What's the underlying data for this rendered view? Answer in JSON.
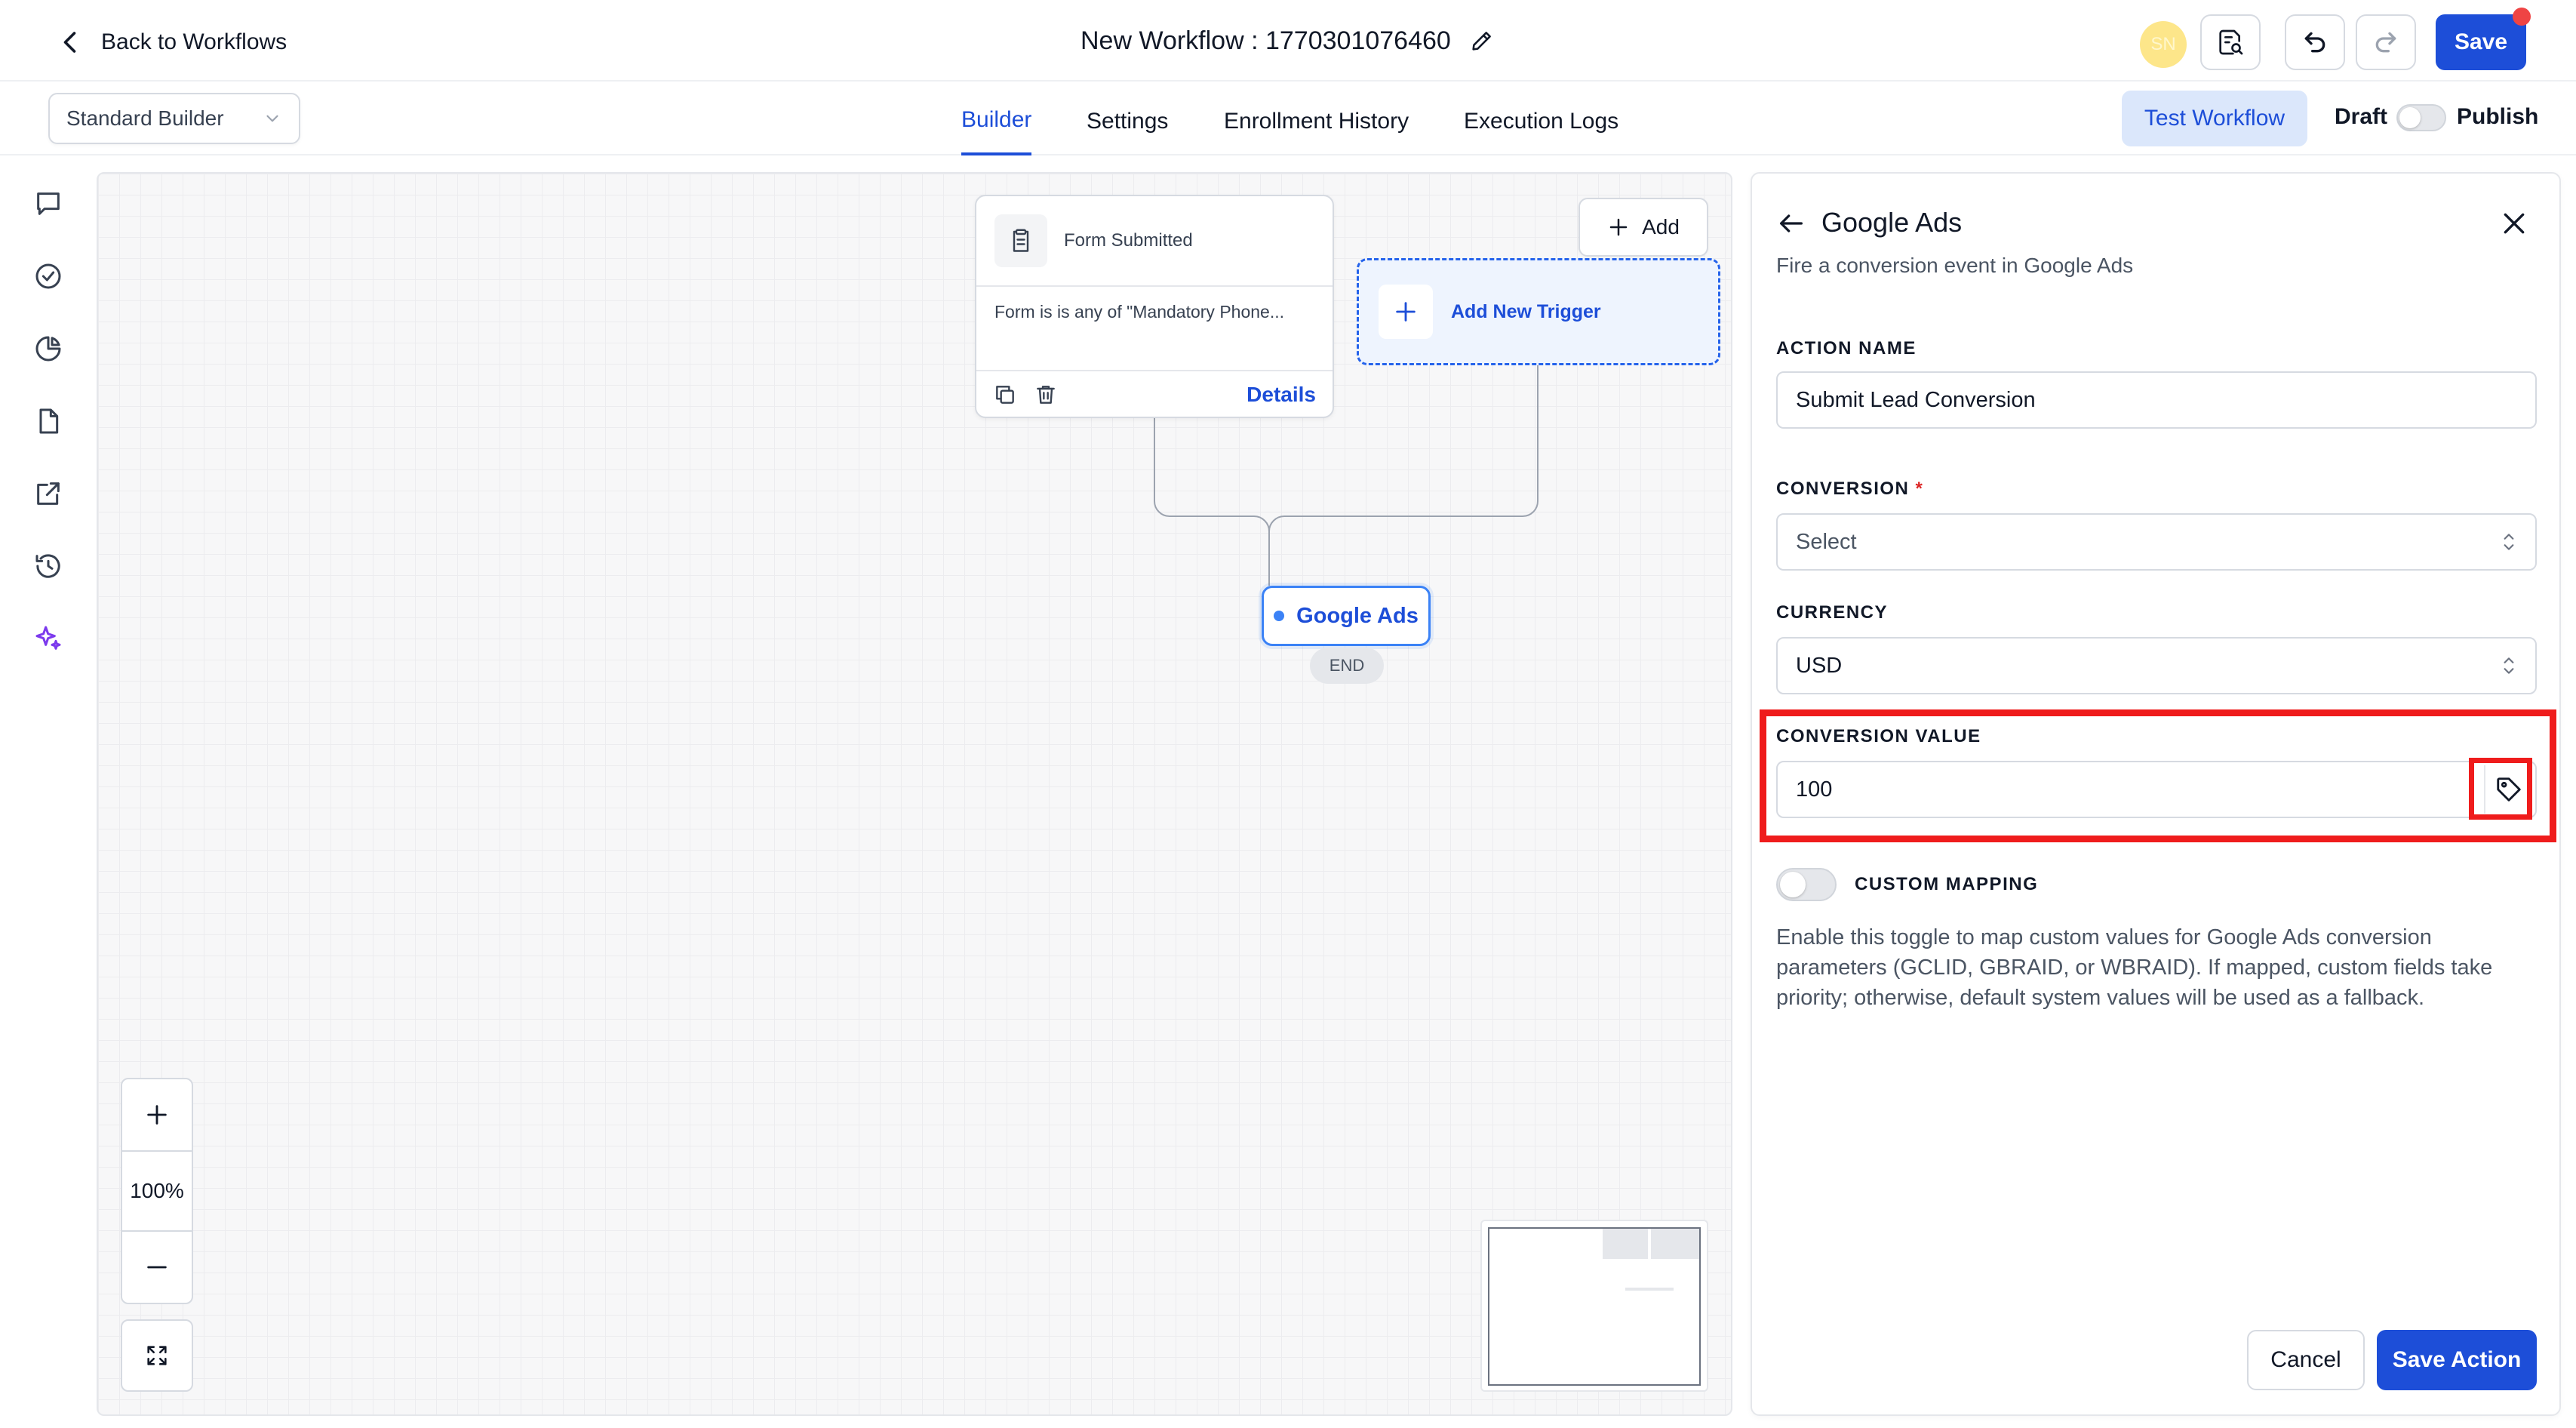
{
  "header": {
    "back_label": "Back to Workflows",
    "workflow_title": "New Workflow : 1770301076460",
    "avatar_initials": "SN",
    "save_label": "Save"
  },
  "subheader": {
    "builder_select_value": "Standard Builder",
    "tabs": [
      {
        "label": "Builder",
        "active": true
      },
      {
        "label": "Settings",
        "active": false
      },
      {
        "label": "Enrollment History",
        "active": false
      },
      {
        "label": "Execution Logs",
        "active": false
      }
    ],
    "test_workflow_label": "Test Workflow",
    "draft_label": "Draft",
    "publish_label": "Publish"
  },
  "rail_icons": [
    "chat-icon",
    "check-circle-icon",
    "pie-chart-icon",
    "file-icon",
    "external-link-icon",
    "history-icon",
    "sparkles-icon"
  ],
  "canvas": {
    "trigger": {
      "title": "Form Submitted",
      "description": "Form is is any of \"Mandatory Phone...",
      "details_label": "Details"
    },
    "add_label": "Add",
    "new_trigger_label": "Add New Trigger",
    "action_node_label": "Google Ads",
    "end_label": "END",
    "zoom_level": "100%"
  },
  "panel": {
    "title": "Google Ads",
    "subtitle": "Fire a conversion event in Google Ads",
    "action_name_label": "ACTION NAME",
    "action_name_value": "Submit Lead Conversion",
    "conversion_label": "CONVERSION",
    "conversion_required_mark": "*",
    "conversion_placeholder": "Select",
    "currency_label": "CURRENCY",
    "currency_value": "USD",
    "conversion_value_label": "CONVERSION VALUE",
    "conversion_value": "100",
    "custom_mapping_label": "CUSTOM MAPPING",
    "custom_mapping_help": "Enable this toggle to map custom values for Google Ads conversion parameters (GCLID, GBRAID, or WBRAID). If mapped, custom fields take priority; otherwise, default system values will be used as a fallback.",
    "cancel_label": "Cancel",
    "save_action_label": "Save Action"
  },
  "colors": {
    "primary": "#1d4ed8",
    "highlight": "#ef1c1c",
    "notification": "#ef4444",
    "avatar": "#fde68a"
  }
}
